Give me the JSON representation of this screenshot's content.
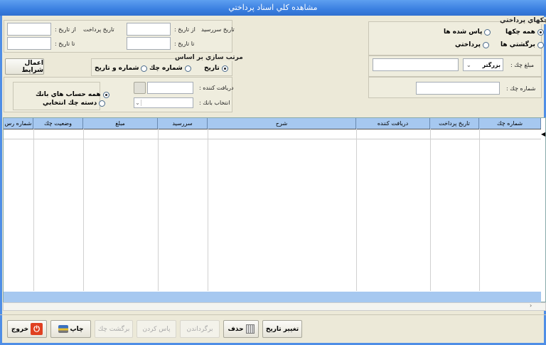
{
  "window": {
    "title": "مشاهده كلي اسناد پرداختي"
  },
  "dates": {
    "due_label": "تاريخ سررسيد",
    "pay_label": "تاريخ پرداخت",
    "from_label": "از تاريخ :",
    "to_label": "تا تاريخ :",
    "due_from": "",
    "due_to": "",
    "pay_from": "",
    "pay_to": ""
  },
  "apply_button": "اعمال شرايط",
  "sort": {
    "title": "مرتب سازي بر اساس",
    "options": [
      "تاريخ",
      "شماره چك",
      "شماره و تاريخ"
    ],
    "selected": 0
  },
  "filter": {
    "receiver_label": "دريافت كننده :",
    "bank_label": "انتخاب بانك :",
    "receiver": "",
    "bank": "",
    "account_options": [
      "همه حساب هاي بانك",
      "دسته چك انتخابي"
    ],
    "account_selected": 0
  },
  "checks": {
    "title": "چكهاي پرداختي",
    "options": [
      "همه چكها",
      "پاس شده ها",
      "برگشتي ها",
      "پرداختي"
    ],
    "selected": 0
  },
  "amount": {
    "label": "مبلغ چك :",
    "operator": "بزرگتر",
    "value": ""
  },
  "check_number": {
    "label": "شماره چك :",
    "value": ""
  },
  "table": {
    "columns": [
      "شماره چك",
      "تاريخ پرداخت",
      "دريافت كننده",
      "شرح",
      "سررسيد",
      "مبلغ",
      "وضعيت چك",
      "شماره رس"
    ]
  },
  "buttons": {
    "change_date": "تغيير تاريخ",
    "delete": "حذف",
    "revert": "برگرداندن",
    "pass": "پاس كردن",
    "bounce": "برگشت چك",
    "print": "چاپ",
    "exit": "خروج"
  }
}
